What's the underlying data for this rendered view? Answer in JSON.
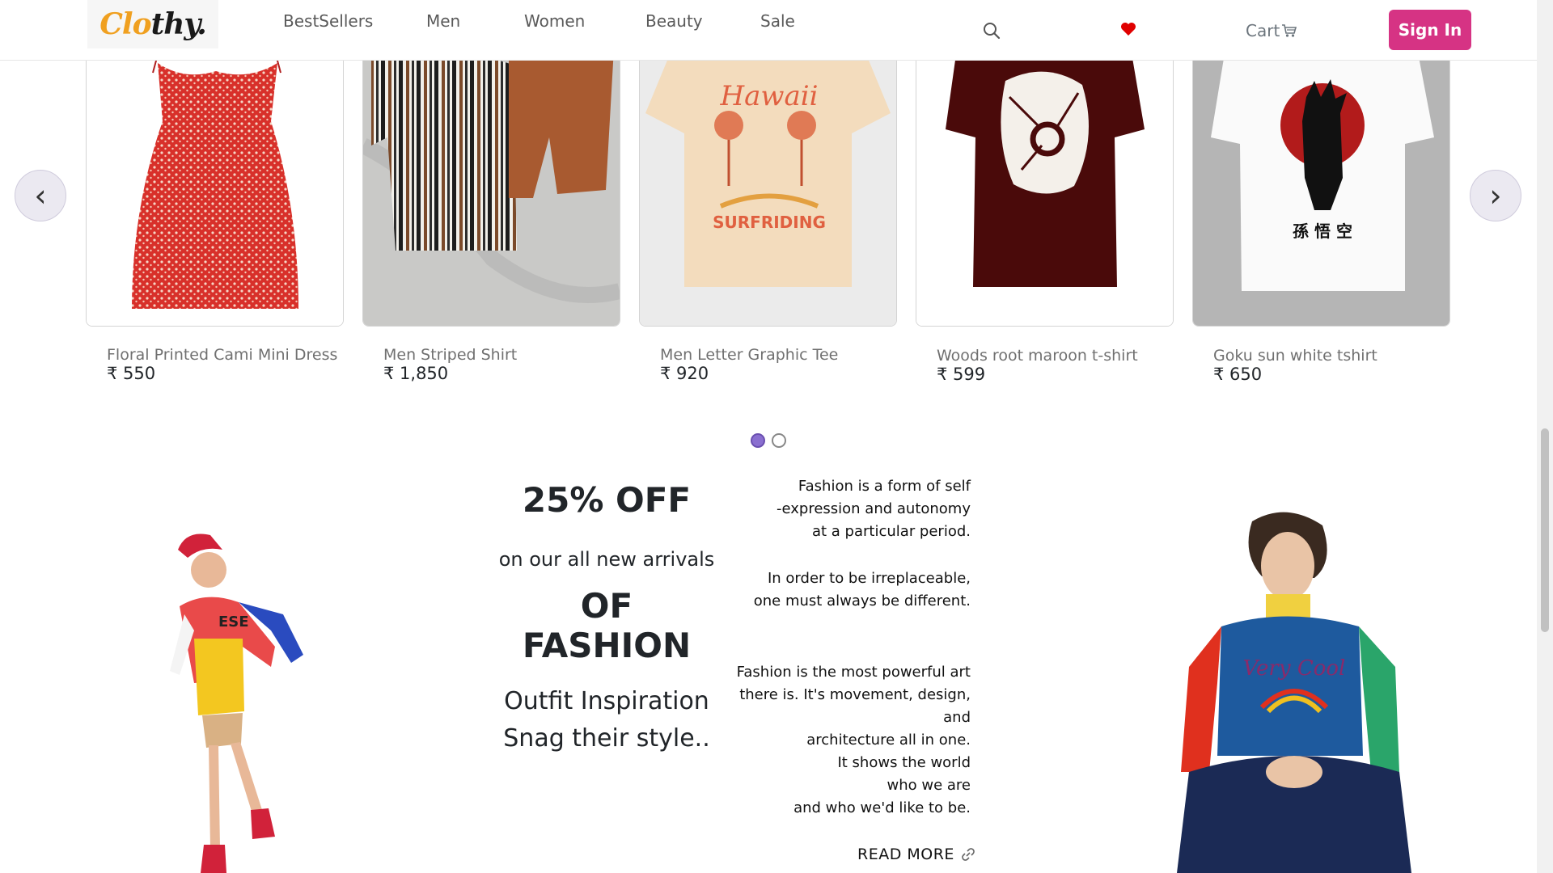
{
  "header": {
    "logo_part1": "Clo",
    "logo_part2": "thy.",
    "nav": [
      "BestSellers",
      "Men",
      "Women",
      "Beauty",
      "Sale"
    ],
    "cart_label": "Cart",
    "signin_label": "Sign In",
    "icons": [
      "search-icon",
      "heart-icon",
      "cart-icon"
    ]
  },
  "carousel": {
    "prev_icon": "‹",
    "next_icon": "›",
    "products": [
      {
        "name": "Floral Printed Cami Mini Dress",
        "price": "₹ 550"
      },
      {
        "name": "Men Striped Shirt",
        "price": "₹ 1,850"
      },
      {
        "name": "Men Letter Graphic Tee",
        "price": "₹ 920"
      },
      {
        "name": "Woods root maroon t-shirt",
        "price": "₹ 599"
      },
      {
        "name": "Goku sun white tshirt",
        "price": "₹ 650"
      }
    ],
    "active_dot": 1,
    "dot_count": 2,
    "tee_print": "Hawaii",
    "tee_print_sub": "SURFRIDING",
    "goku_glyphs": "孫 悟 空"
  },
  "promo": {
    "discount": "25% OFF",
    "subtitle": "on our all new arrivals",
    "headline": "OF FASHION",
    "inspiration_line1": "Outfit Inspiration",
    "inspiration_line2": "Snag their style..",
    "quote1": [
      "Fashion is a form of self",
      "-expression and autonomy",
      "at a particular period."
    ],
    "quote2": [
      "In order to be irreplaceable,",
      "one must always be different."
    ],
    "quote3": [
      "Fashion is the most powerful art",
      "there is. It's movement, design,",
      "and",
      "architecture all in one.",
      "It shows the world",
      "who we are",
      "and who we'd like to be."
    ],
    "read_more": "READ MORE",
    "model_left_shirt_text": "ESE",
    "model_right_shirt_text": "Very Cool"
  },
  "colors": {
    "brand_orange": "#f0a020",
    "signin_pink": "#d63384",
    "heart_red": "#e00000",
    "active_dot": "#8a6fd0"
  }
}
